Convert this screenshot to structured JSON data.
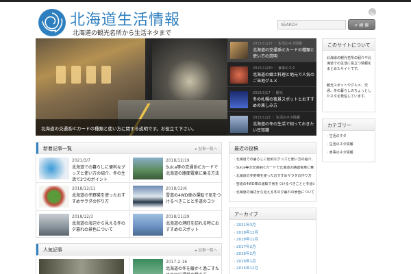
{
  "header": {
    "site_title": "北海道生活情報",
    "site_description": "北海道の観光名所から生活ネタまで",
    "search_placeholder": "SEARCH",
    "search_button": "検 索",
    "logo_icon": "rose-flower-icon",
    "rss_icon": "rss-icon"
  },
  "hero": {
    "caption": "北海道の交通系ICカードの種類と使い方に関する説明です。お役立て下さい。"
  },
  "slider": [
    {
      "date": "2015/11/27 ｜ 生活のネタ情報",
      "title": "北海道の交通系ICカードの種類と使い方の説明",
      "thumb": "#8a7a60"
    },
    {
      "date": "2015/12/30 ｜ 食事のネタ",
      "title": "北海道の郷土料理と地元で人気のご当地グルメ",
      "thumb": "#b04a3a"
    },
    {
      "date": "2016/1/17 ｜ 観光",
      "title": "冬の札幌の夜景スポットとおすすめの楽しみ方",
      "thumb": "#3a4a8a"
    },
    {
      "date": "2015/12/2 ｜ 生活のネタ情報",
      "title": "北海道の冬の生活で知っておきたい豆知識",
      "thumb": "#5a7090"
    }
  ],
  "posts_section": {
    "title": "新着記事一覧",
    "more": "▸ 記事一覧へ",
    "items": [
      {
        "date": "2021/3/7",
        "title": "北海道での暮らしに便利なグッズと使い方の紹介、冬の生活で3つのポイント",
        "thumb": "#2a7ab8"
      },
      {
        "date": "2018/12/19",
        "title": "Suica等の交通系ICカードで北海道の路面電車に乗る方法",
        "thumb": "#6a8a6a"
      },
      {
        "date": "2018/12/11",
        "title": "北海道の冬野菜を使ったおすすめサラダの作り方",
        "thumb": "#5a8a3a"
      },
      {
        "date": "2018/12/6",
        "title": "雪道の4WD車の運転で気をつけるべきことと冬道のコツ",
        "thumb": "#a8b8c8"
      },
      {
        "date": "2018/12/3",
        "title": "北海道の海辺から見える冬の夕暮れの景色について",
        "thumb": "#8a96a0"
      },
      {
        "date": "2018/11/29",
        "title": "北海道の港町を訪れる時におすすめのスポット",
        "thumb": "#7a9ab8"
      }
    ]
  },
  "posts_section2": {
    "title": "人気記事",
    "more": "▸ 記事一覧へ",
    "items": [
      {
        "date": "",
        "title": "",
        "thumb": "#6a6a5a"
      },
      {
        "date": "2017-2-16",
        "title": "北海道の冬を暖かく過ごすためのWiFi環境の整え方",
        "thumb": "#4a8a5a"
      }
    ]
  },
  "recent_section": {
    "title": "最近の投稿",
    "items": [
      "北海道での暮らしに便利なグッズと使い方の紹介、冬の生活で3つのポイント",
      "Suica等の交通系ICカードで北海道の路面電車に乗る方法について",
      "北海道の冬野菜を使ったおすすめサラダの作り方",
      "雪道の4WD車の運転で気をつけるべきことと冬道のコツ",
      "北海道の海辺から見える冬の夕暮れの景色について"
    ]
  },
  "archive_section": {
    "title": "アーカイブ",
    "items": [
      "2021年3月",
      "2018年12月",
      "2018年11月",
      "2017年2月",
      "2016年2月",
      "2016年1月",
      "2015年12月"
    ]
  },
  "side_about": {
    "title": "このサイトについて",
    "p1": "北海道の観光名所の紹介や北海道での生活に役立つ情報をまとめたサイトです。",
    "p2": "観光スポットやグルメ、交通、冬の暮らしのちょっとしたネタを発信しています。"
  },
  "side_categories": {
    "title": "カテゴリー",
    "items": [
      "生活のネタ",
      "生活のネタ情報",
      "食事のネタ情報"
    ]
  },
  "colors": {
    "accent": "#2e7fbf",
    "dark_panel": "#222222"
  }
}
